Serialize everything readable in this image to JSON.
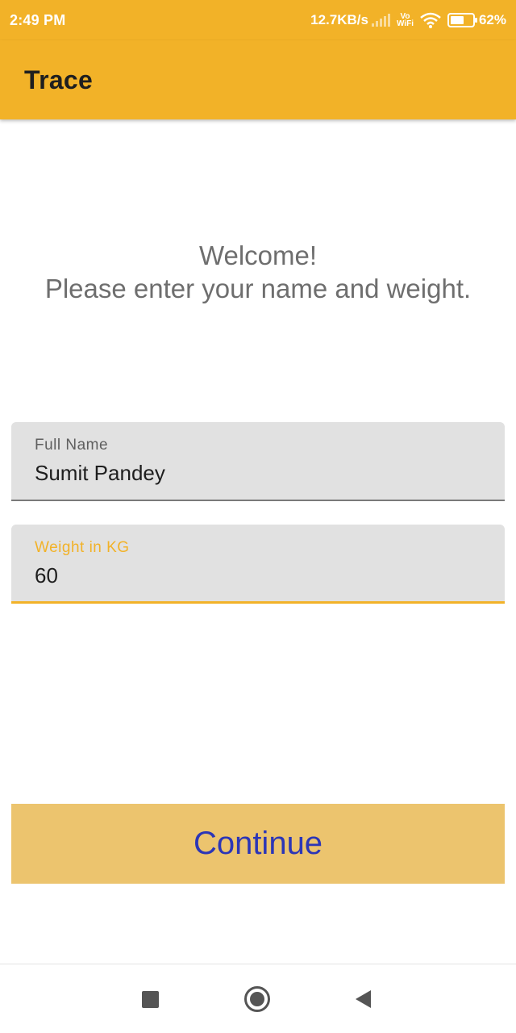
{
  "status_bar": {
    "time": "2:49 PM",
    "network_speed": "12.7KB/s",
    "vowifi_top": "Vo",
    "vowifi_bottom": "WiFi",
    "battery_level": 0.62,
    "battery_percent": "62%",
    "icons": [
      "signal-icon",
      "vowifi-icon",
      "wifi-icon",
      "battery-icon"
    ]
  },
  "app_bar": {
    "title": "Trace"
  },
  "welcome": {
    "line1": "Welcome!",
    "line2": "Please enter your name and weight."
  },
  "form": {
    "name_label": "Full Name",
    "name_value": "Sumit Pandey",
    "weight_label": "Weight in KG",
    "weight_value": "60"
  },
  "continue_button": {
    "label": "Continue"
  },
  "nav_bar": {
    "icons": [
      "recents-square-icon",
      "home-circle-icon",
      "back-triangle-icon"
    ]
  },
  "colors": {
    "primary": "#f2b228",
    "button_bg": "#ecc46e",
    "button_text": "#2c36b6",
    "field_bg": "#e1e1e1"
  }
}
